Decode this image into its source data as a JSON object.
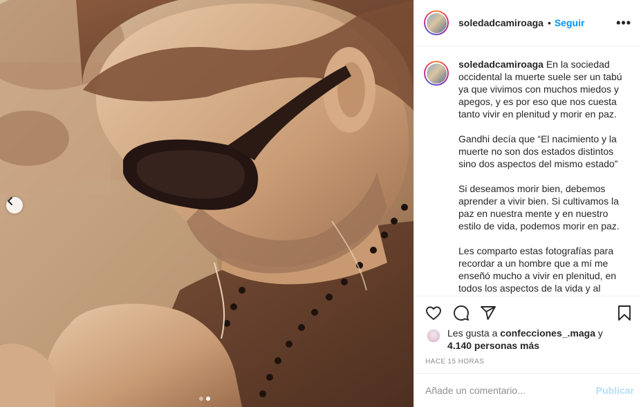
{
  "post": {
    "photo_alt": "photo",
    "carousel_prev_icon": "chevron-left-icon",
    "carousel_count": 2,
    "carousel_active": 2
  },
  "header": {
    "username": "soledadcamiroaga",
    "separator": "•",
    "follow_label": "Seguir",
    "more_icon": "more-options-icon",
    "more_label": "•••"
  },
  "caption": {
    "username": "soledadcamiroaga",
    "paragraphs": [
      "En la sociedad occidental la muerte suele ser un tabú ya que vivimos con muchos miedos y apegos, y es por eso que nos cuesta tanto vivir en plenitud y morir en paz.",
      "Gandhi decía que “El nacimiento y la muerte no son dos estados distintos sino dos aspectos del mismo estado”",
      "Si deseamos morir bien, debemos aprender a vivir bien. Si cultivamos la paz en nuestra mente y en nuestro estilo de vida, podemos morir en paz.",
      "Les comparto estas fotografías para recordar a un hombre que a mí me enseñó mucho a vivir en plenitud, en todos los aspectos de la vida y al"
    ]
  },
  "actions": {
    "like_icon": "heart-icon",
    "comment_icon": "comment-icon",
    "share_icon": "share-icon",
    "save_icon": "bookmark-icon"
  },
  "likes": {
    "prefix": "Les gusta a ",
    "liker": "confecciones_.maga",
    "middle": " y ",
    "others": "4.140 personas más"
  },
  "time_ago": "Hace 15 horas",
  "comment": {
    "placeholder": "Añade un comentario...",
    "publish_label": "Publicar"
  },
  "colors": {
    "accent": "#0095f6",
    "publish_disabled": "#b2dffc",
    "text": "#262626",
    "muted": "#8e8e8e",
    "border": "#efefef",
    "photo_tone": "#b8906c"
  }
}
